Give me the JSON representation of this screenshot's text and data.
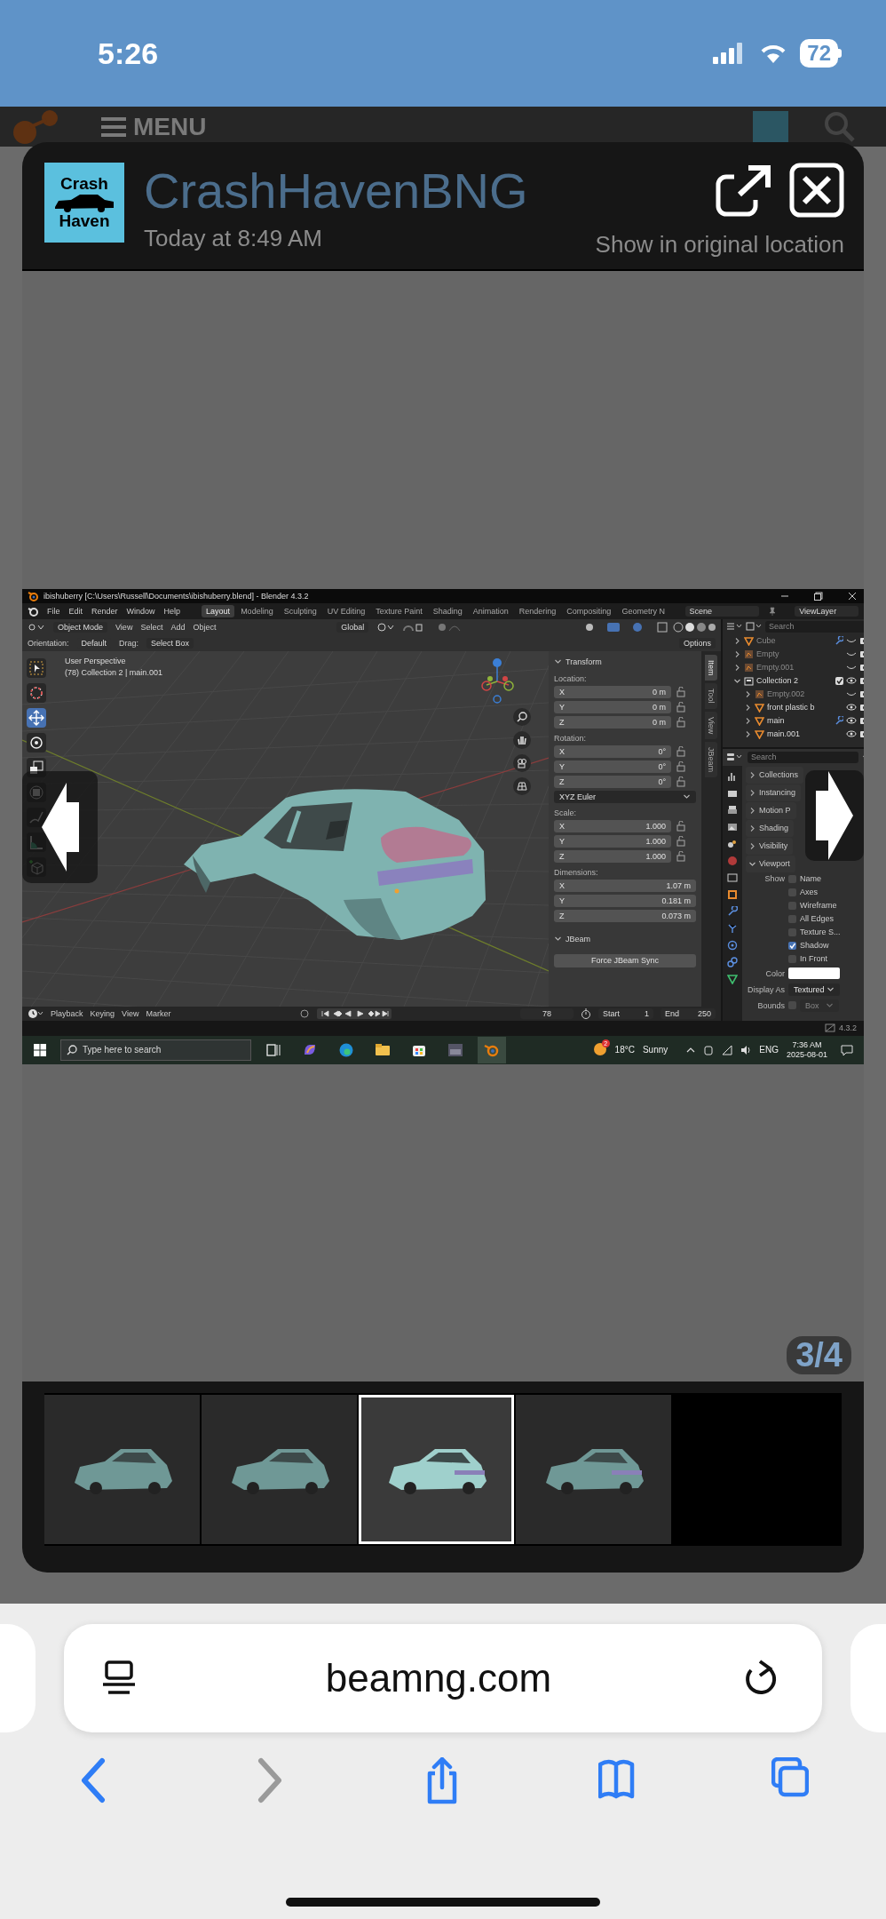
{
  "status_bar": {
    "time": "5:26",
    "battery": "72"
  },
  "site_header": {
    "menu": "MENU"
  },
  "lightbox": {
    "avatar_lines": [
      "Crash",
      "Haven"
    ],
    "author": "CrashHavenBNG",
    "date": "Today at 8:49 AM",
    "original_link": "Show in original location",
    "counter": "3/4",
    "screenshot": {
      "title": "ibishuberry [C:\\Users\\Russell\\Documents\\ibishuberry.blend] - Blender 4.3.2",
      "menus": [
        "File",
        "Edit",
        "Render",
        "Window",
        "Help"
      ],
      "workspaces": [
        {
          "label": "Layout",
          "selected": true
        },
        {
          "label": "Modeling",
          "selected": false
        },
        {
          "label": "Sculpting",
          "selected": false
        },
        {
          "label": "UV Editing",
          "selected": false
        },
        {
          "label": "Texture Paint",
          "selected": false
        },
        {
          "label": "Shading",
          "selected": false
        },
        {
          "label": "Animation",
          "selected": false
        },
        {
          "label": "Rendering",
          "selected": false
        },
        {
          "label": "Compositing",
          "selected": false
        },
        {
          "label": "Geometry N",
          "selected": false
        }
      ],
      "scene": "Scene",
      "view_layer": "ViewLayer",
      "header": {
        "mode": "Object Mode",
        "menus": [
          "View",
          "Select",
          "Add",
          "Object"
        ],
        "transform_orientation": "Global"
      },
      "tool_settings": {
        "orientation_label": "Orientation:",
        "orientation": "Default",
        "drag_label": "Drag:",
        "drag": "Select Box",
        "options": "Options"
      },
      "viewport": {
        "perspective": "User Perspective",
        "context": "(78) Collection 2 | main.001"
      },
      "tools": [
        {
          "kind": "select_box",
          "selected": false
        },
        {
          "kind": "cursor",
          "selected": false
        },
        {
          "kind": "move",
          "selected": true
        },
        {
          "kind": "rotate",
          "selected": false
        },
        {
          "kind": "scale",
          "selected": false
        },
        {
          "kind": "transform",
          "selected": false
        },
        {
          "kind": "annotate",
          "selected": false
        },
        {
          "kind": "measure",
          "selected": false
        },
        {
          "kind": "add_cube",
          "selected": false
        }
      ],
      "n_panel": {
        "title": "Transform",
        "groups": [
          {
            "label": "Location:",
            "locks": true,
            "fields": [
              {
                "axis": "X",
                "value": "0 m"
              },
              {
                "axis": "Y",
                "value": "0 m"
              },
              {
                "axis": "Z",
                "value": "0 m"
              }
            ]
          },
          {
            "label": "Rotation:",
            "locks": true,
            "mode": "XYZ Euler",
            "fields": [
              {
                "axis": "X",
                "value": "0°"
              },
              {
                "axis": "Y",
                "value": "0°"
              },
              {
                "axis": "Z",
                "value": "0°"
              }
            ]
          },
          {
            "label": "Scale:",
            "locks": true,
            "fields": [
              {
                "axis": "X",
                "value": "1.000"
              },
              {
                "axis": "Y",
                "value": "1.000"
              },
              {
                "axis": "Z",
                "value": "1.000"
              }
            ]
          },
          {
            "label": "Dimensions:",
            "locks": false,
            "fields": [
              {
                "axis": "X",
                "value": "1.07 m"
              },
              {
                "axis": "Y",
                "value": "0.181 m"
              },
              {
                "axis": "Z",
                "value": "0.073 m"
              }
            ]
          }
        ],
        "jbeam_title": "JBeam",
        "jbeam_button": "Force JBeam Sync"
      },
      "side_tabs": [
        {
          "label": "Item",
          "selected": true
        },
        {
          "label": "Tool",
          "selected": false
        },
        {
          "label": "View",
          "selected": false
        },
        {
          "label": "JBeam",
          "selected": false
        }
      ],
      "outliner": {
        "search_placeholder": "Search",
        "items": [
          {
            "name": "Cube",
            "kind": "mesh",
            "expanded": false,
            "visible": false,
            "modifier": true
          },
          {
            "name": "Empty",
            "kind": "empty",
            "expanded": false,
            "visible": false,
            "modifier": false
          },
          {
            "name": "Empty.001",
            "kind": "empty",
            "expanded": false,
            "visible": false,
            "modifier": false
          },
          {
            "name": "Collection 2",
            "kind": "collection",
            "expanded": true,
            "visible": true,
            "modifier": false,
            "checked": true,
            "children": [
              {
                "name": "Empty.002",
                "kind": "empty",
                "expanded": false,
                "visible": false,
                "modifier": false
              },
              {
                "name": "front plastic b",
                "kind": "mesh",
                "expanded": false,
                "visible": true,
                "modifier": false
              },
              {
                "name": "main",
                "kind": "mesh",
                "expanded": false,
                "visible": true,
                "modifier": true
              },
              {
                "name": "main.001",
                "kind": "mesh",
                "expanded": false,
                "visible": true,
                "modifier": false
              }
            ]
          }
        ]
      },
      "properties": {
        "search_placeholder": "Search",
        "sections": [
          {
            "label": "Collections",
            "expanded": false
          },
          {
            "label": "Instancing",
            "expanded": false
          },
          {
            "label": "Motion P",
            "expanded": false
          },
          {
            "label": "Shading",
            "expanded": false
          },
          {
            "label": "Visibility",
            "expanded": false
          },
          {
            "label": "Viewport",
            "expanded": true
          }
        ],
        "show_label": "Show",
        "options": [
          {
            "label": "Name",
            "checked": false
          },
          {
            "label": "Axes",
            "checked": false
          },
          {
            "label": "Wireframe",
            "checked": false
          },
          {
            "label": "All Edges",
            "checked": false
          },
          {
            "label": "Texture S...",
            "checked": false
          },
          {
            "label": "Shadow",
            "checked": true
          },
          {
            "label": "In Front",
            "checked": false
          }
        ],
        "color_label": "Color",
        "display_as": {
          "label": "Display As",
          "value": "Textured"
        },
        "bounds": {
          "label": "Bounds",
          "checked": false,
          "value": "Box"
        }
      },
      "timeline": {
        "menus": [
          "Playback",
          "Keying",
          "View",
          "Marker"
        ],
        "frame": "78",
        "start_label": "Start",
        "start": "1",
        "end_label": "End",
        "end": "250"
      },
      "version": "4.3.2",
      "taskbar": {
        "search_placeholder": "Type here to search",
        "weather_badge": "2",
        "temperature": "18°C",
        "weather": "Sunny",
        "language": "ENG",
        "time": "7:36 AM",
        "date": "2025-08-01"
      }
    },
    "thumbnails": [
      {
        "selected": false
      },
      {
        "selected": false
      },
      {
        "selected": true
      },
      {
        "selected": false
      }
    ]
  },
  "browser": {
    "url": "beamng.com",
    "nav_buttons": [
      {
        "kind": "back",
        "disabled": false
      },
      {
        "kind": "forward",
        "disabled": true
      },
      {
        "kind": "share",
        "disabled": false
      },
      {
        "kind": "bookmarks",
        "disabled": false
      },
      {
        "kind": "tabs",
        "disabled": false
      }
    ]
  }
}
